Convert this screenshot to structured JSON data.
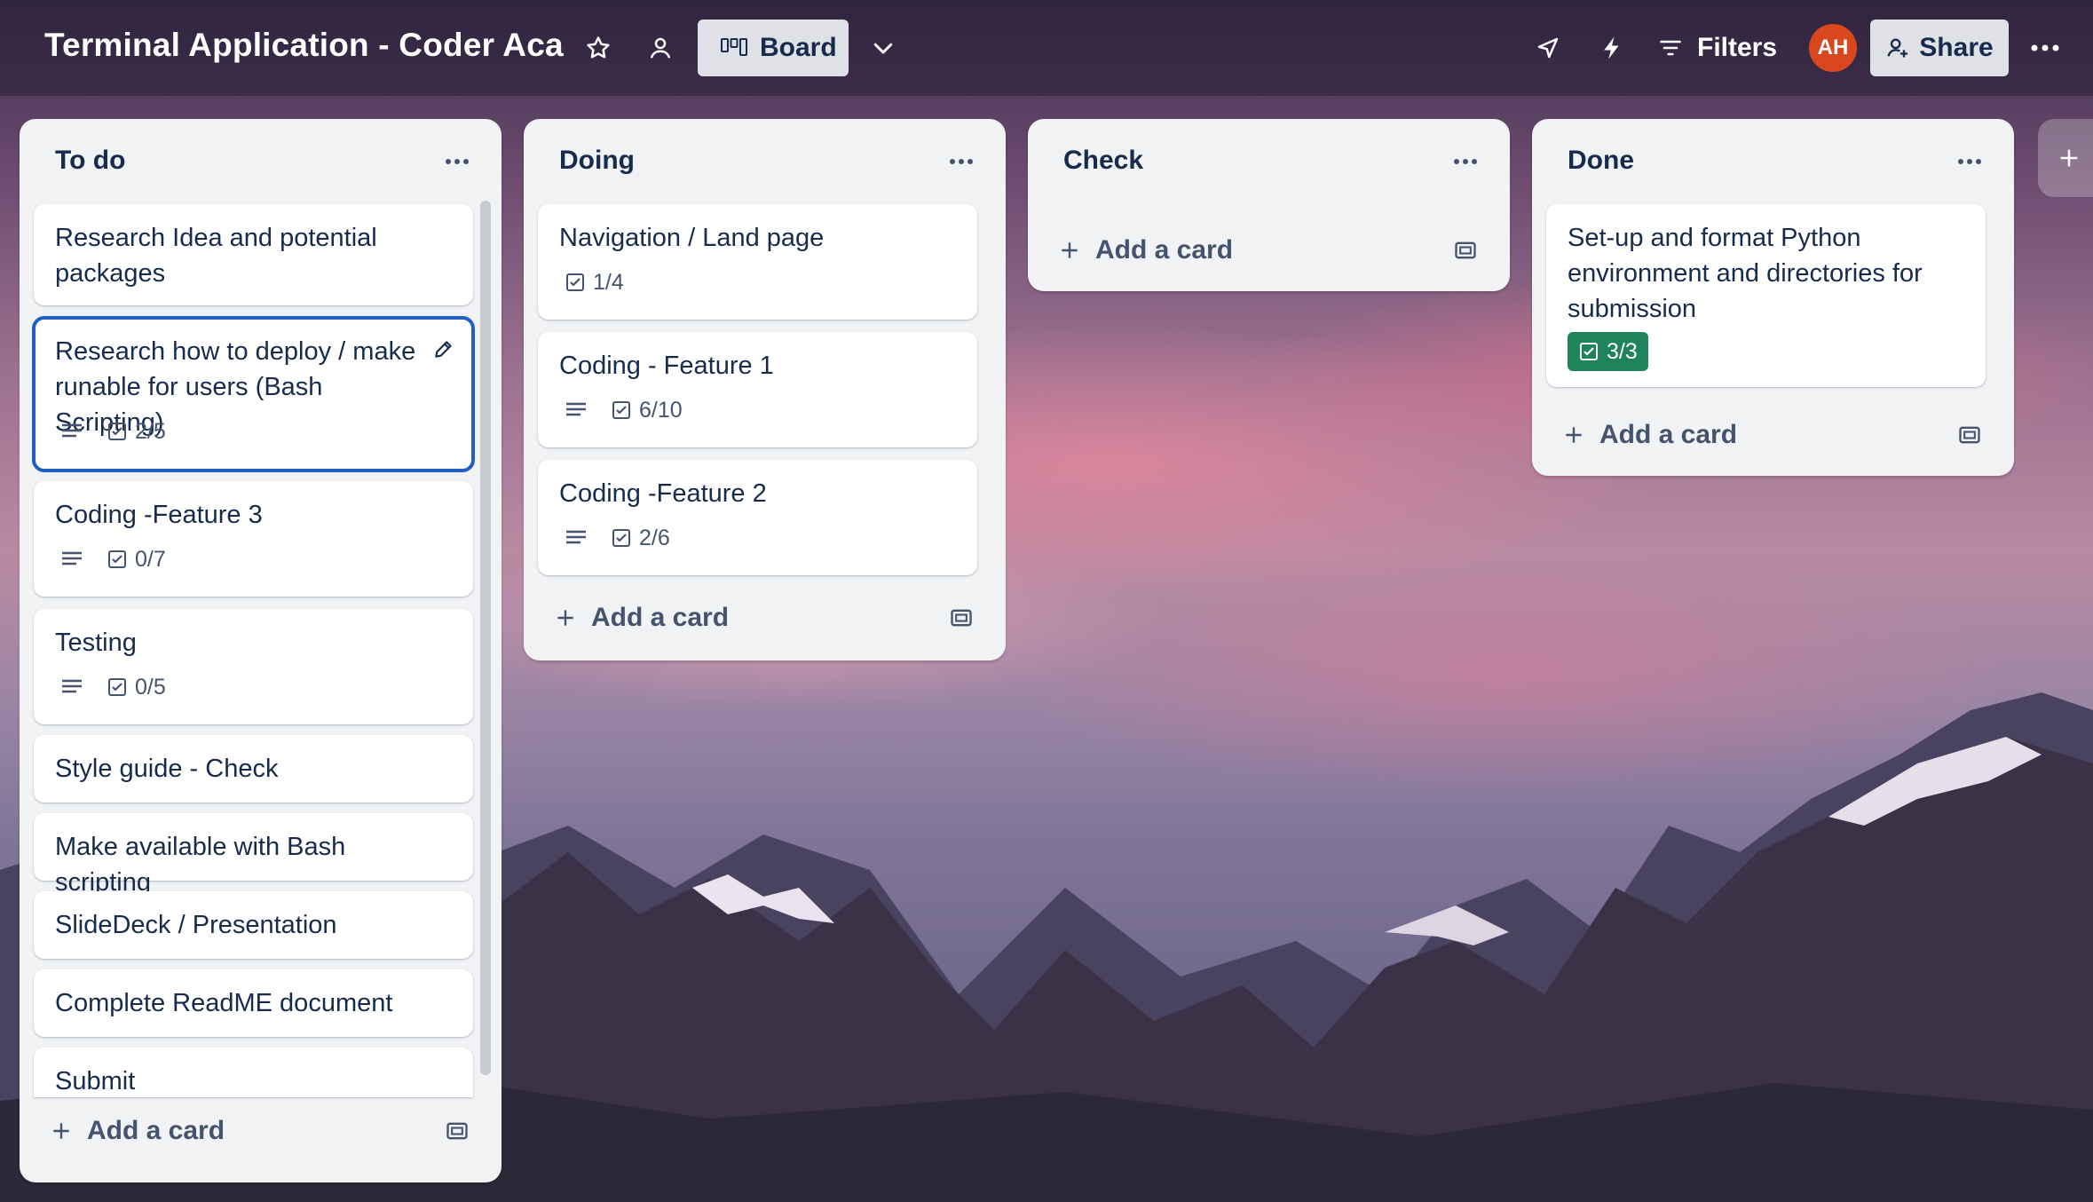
{
  "topbar": {
    "board_title": "Terminal Application - Coder Aca",
    "view_label": "Board",
    "filters_label": "Filters",
    "avatar_initials": "AH",
    "share_label": "Share",
    "icons": [
      "star-icon",
      "workspace-visibility-icon",
      "board-view-icon",
      "chevron-down-icon",
      "power-ups-icon",
      "automation-icon",
      "filter-icon",
      "more-icon"
    ]
  },
  "lists": [
    {
      "title": "To do",
      "cards": [
        {
          "title": "Research Idea and potential packages"
        },
        {
          "title": "Research how to deploy / make runable for users (Bash Scripting)",
          "description": true,
          "checklist": "2/5",
          "selected": true
        },
        {
          "title": "Coding -Feature 3",
          "description": true,
          "checklist": "0/7"
        },
        {
          "title": "Testing",
          "description": true,
          "checklist": "0/5"
        },
        {
          "title": "Style guide - Check"
        },
        {
          "title": "Make available with Bash scripting"
        },
        {
          "title": "SlideDeck / Presentation"
        },
        {
          "title": "Complete ReadME document"
        },
        {
          "title": "Submit"
        }
      ],
      "add_card_label": "Add a card"
    },
    {
      "title": "Doing",
      "cards": [
        {
          "title": "Navigation / Land page",
          "checklist": "1/4"
        },
        {
          "title": "Coding - Feature 1",
          "description": true,
          "checklist": "6/10"
        },
        {
          "title": "Coding -Feature 2",
          "description": true,
          "checklist": "2/6"
        }
      ],
      "add_card_label": "Add a card"
    },
    {
      "title": "Check",
      "cards": [],
      "add_card_label": "Add a card"
    },
    {
      "title": "Done",
      "cards": [
        {
          "title": "Set-up and format Python environment and directories for submission",
          "checklist": "3/3",
          "complete": true
        }
      ],
      "add_card_label": "Add a card"
    }
  ],
  "colors": {
    "accent_blue": "#1f5fc4",
    "complete_green": "#1f845a",
    "avatar": "#d9471f",
    "list_bg": "#f1f2f4"
  }
}
